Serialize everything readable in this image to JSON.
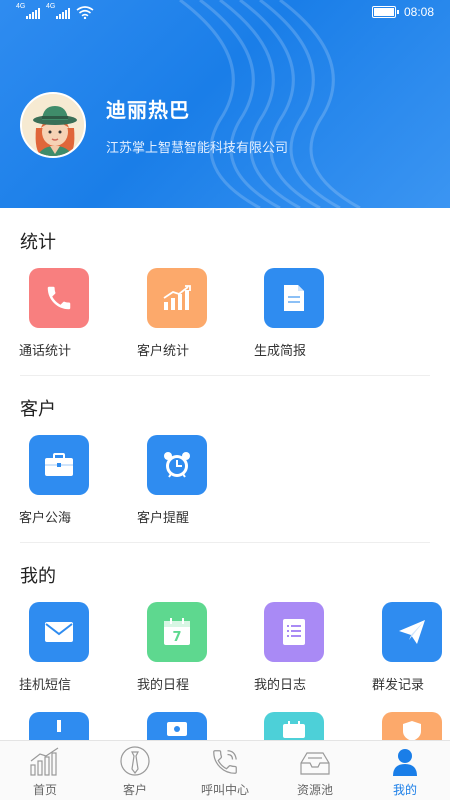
{
  "status_bar": {
    "sim1": "4G",
    "sim2": "4G",
    "time": "08:08"
  },
  "profile": {
    "name": "迪丽热巴",
    "company": "江苏掌上智慧智能科技有限公司"
  },
  "sections": {
    "stats": {
      "title": "统计",
      "items": [
        {
          "label": "通话统计",
          "icon": "phone-icon",
          "color": "#f87f7f"
        },
        {
          "label": "客户统计",
          "icon": "bar-chart-icon",
          "color": "#fca96b"
        },
        {
          "label": "生成简报",
          "icon": "document-icon",
          "color": "#2f8cf0"
        }
      ]
    },
    "customer": {
      "title": "客户",
      "items": [
        {
          "label": "客户公海",
          "icon": "briefcase-icon",
          "color": "#2f8cf0"
        },
        {
          "label": "客户提醒",
          "icon": "alarm-clock-icon",
          "color": "#2f8cf0"
        }
      ]
    },
    "mine": {
      "title": "我的",
      "items": [
        {
          "label": "挂机短信",
          "icon": "mail-icon",
          "color": "#2f8cf0"
        },
        {
          "label": "我的日程",
          "icon": "calendar-icon",
          "color": "#5ed88f"
        },
        {
          "label": "我的日志",
          "icon": "notepad-icon",
          "color": "#a98af5"
        },
        {
          "label": "群发记录",
          "icon": "paper-plane-icon",
          "color": "#2f8cf0"
        }
      ],
      "partial_row_colors": [
        "#2f8cf0",
        "#2f8cf0",
        "#4dd0d8",
        "#fca96b"
      ]
    }
  },
  "tabbar": [
    {
      "label": "首页",
      "icon": "home-chart-icon",
      "active": false
    },
    {
      "label": "客户",
      "icon": "customer-tie-icon",
      "active": false
    },
    {
      "label": "呼叫中心",
      "icon": "phone-call-icon",
      "active": false
    },
    {
      "label": "资源池",
      "icon": "inbox-tray-icon",
      "active": false
    },
    {
      "label": "我的",
      "icon": "person-icon",
      "active": true
    }
  ]
}
